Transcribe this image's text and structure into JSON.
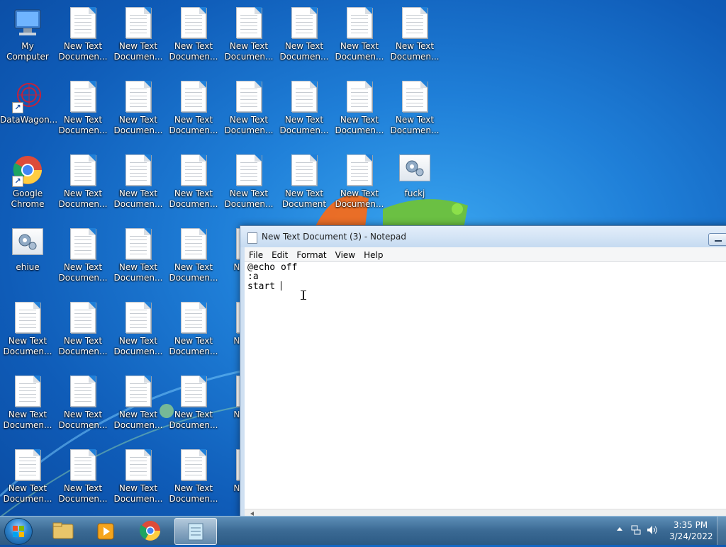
{
  "desktop": {
    "icons": [
      {
        "label": "My Computer",
        "type": "computer"
      },
      {
        "label": "DataWagon...",
        "type": "datawagon"
      },
      {
        "label": "Google Chrome",
        "type": "chrome"
      },
      {
        "label": "ehiue",
        "type": "gear"
      },
      {
        "label": "fuckj",
        "type": "gear"
      },
      {
        "label": "New Text Documen...",
        "type": "doc"
      },
      {
        "label": "New Text Document",
        "type": "doc"
      },
      {
        "label": "Ne Doc",
        "type": "doc"
      }
    ]
  },
  "notepad": {
    "title": "New Text Document (3) - Notepad",
    "menu": [
      "File",
      "Edit",
      "Format",
      "View",
      "Help"
    ],
    "lines": [
      "@echo off",
      ":a",
      "start "
    ]
  },
  "taskbar": {
    "clock_time": "3:35 PM",
    "clock_date": "3/24/2022"
  }
}
